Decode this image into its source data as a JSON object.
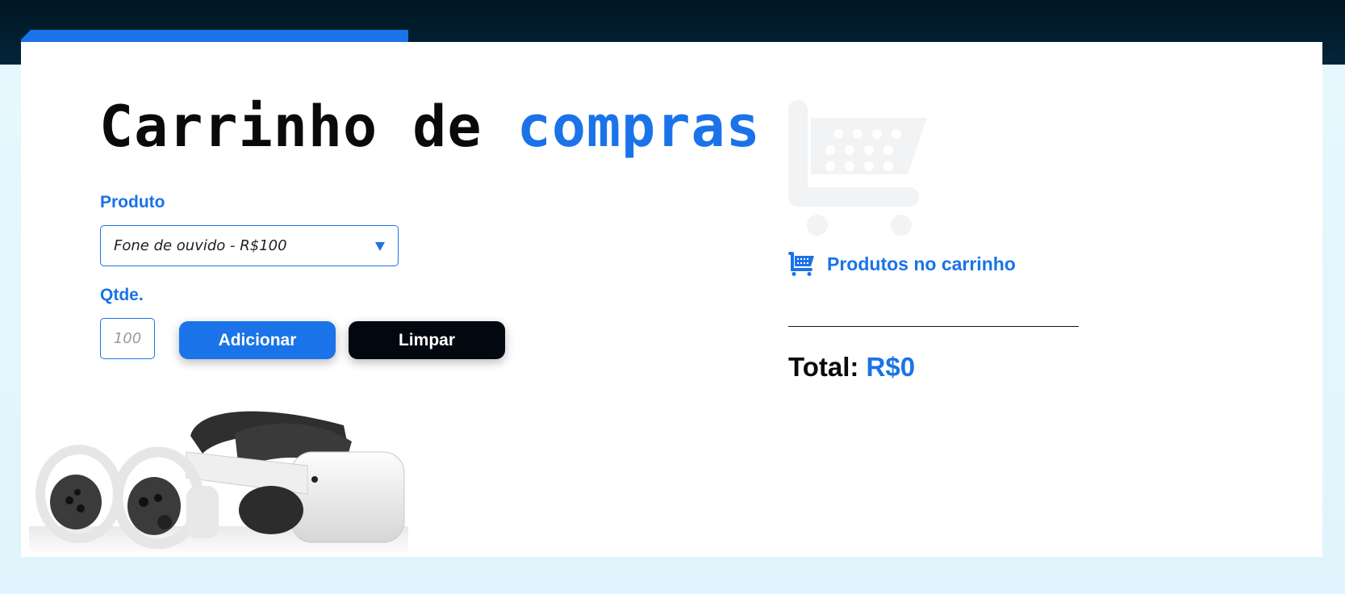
{
  "page": {
    "title_part1": "Carrinho de",
    "title_part2": "compras"
  },
  "form": {
    "product_label": "Produto",
    "product_selected": "Fone de ouvido - R$100",
    "qty_label": "Qtde.",
    "qty_placeholder": "100",
    "add_button": "Adicionar",
    "clear_button": "Limpar"
  },
  "cart": {
    "title": "Produtos no carrinho",
    "items": [],
    "total_label": "Total:",
    "total_value": "R$0"
  },
  "icons": {
    "dropdown": "caret-down-icon",
    "cart_large": "shopping-cart-icon",
    "cart_small": "shopping-cart-icon",
    "product_image": "vr-headset-image"
  },
  "colors": {
    "accent": "#1a73e8",
    "dark": "#02080f",
    "header_bg": "#011521",
    "page_bg": "#e2f6fd",
    "card_bg": "#ffffff",
    "cart_watermark": "#f2f3f4"
  }
}
